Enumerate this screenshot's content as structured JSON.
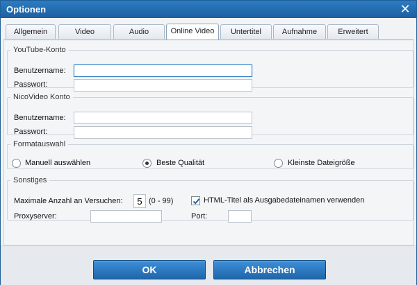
{
  "window": {
    "title": "Optionen",
    "close_icon": "close-icon"
  },
  "tabs": [
    {
      "label": "Allgemein",
      "active": false
    },
    {
      "label": "Video",
      "active": false
    },
    {
      "label": "Audio",
      "active": false
    },
    {
      "label": "Online Video",
      "active": true
    },
    {
      "label": "Untertitel",
      "active": false
    },
    {
      "label": "Aufnahme",
      "active": false
    },
    {
      "label": "Erweitert",
      "active": false
    }
  ],
  "youtube": {
    "legend": "YouTube-Konto",
    "username_label": "Benutzername:",
    "password_label": "Passwort:",
    "username_value": "",
    "password_value": ""
  },
  "nicovideo": {
    "legend": "NicoVideo Konto",
    "username_label": "Benutzername:",
    "password_label": "Passwort:",
    "username_value": "",
    "password_value": ""
  },
  "format": {
    "legend": "Formatauswahl",
    "options": [
      {
        "label": "Manuell auswählen",
        "selected": false
      },
      {
        "label": "Beste Qualität",
        "selected": true
      },
      {
        "label": "Kleinste Dateigröße",
        "selected": false
      }
    ]
  },
  "misc": {
    "legend": "Sonstiges",
    "max_attempts_label": "Maximale Anzahl an Versuchen:",
    "max_attempts_value": "5",
    "max_attempts_range": "(0 - 99)",
    "html_title_label": "HTML-Titel als Ausgabedateinamen verwenden",
    "html_title_checked": true,
    "proxy_label": "Proxyserver:",
    "proxy_value": "",
    "port_label": "Port:",
    "port_value": ""
  },
  "buttons": {
    "ok": "OK",
    "cancel": "Abbrechen"
  },
  "colors": {
    "titlebar": "#1c5f9f",
    "button": "#1f66aa"
  }
}
